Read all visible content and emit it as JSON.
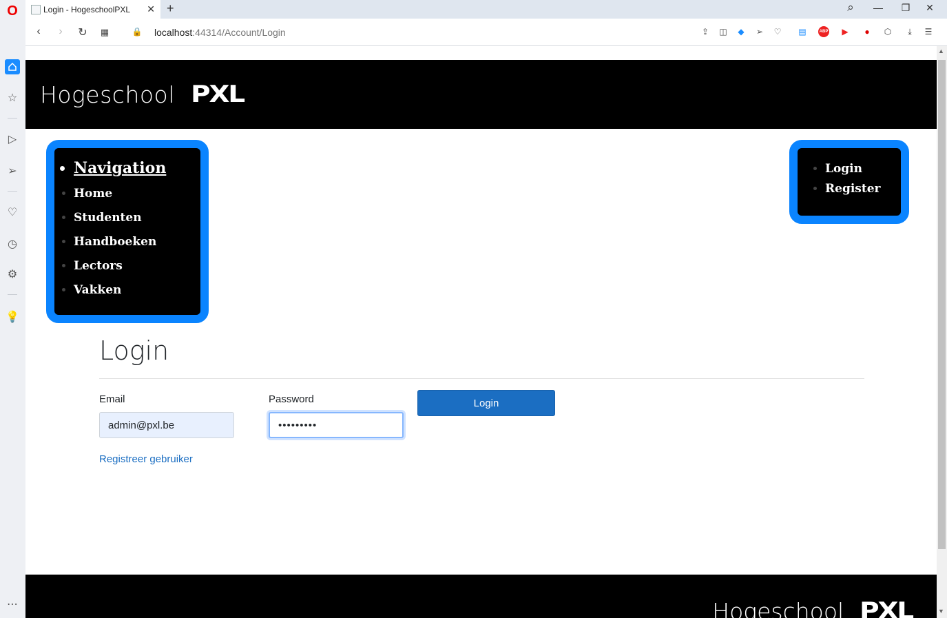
{
  "browser": {
    "tab_title": "Login - HogeschoolPXL",
    "tab_close": "✕",
    "new_tab": "+",
    "url_host": "localhost",
    "url_path": ":44314/Account/Login",
    "window_controls": {
      "search": "⌕",
      "minimize": "—",
      "restore": "❐",
      "close": "✕"
    }
  },
  "header": {
    "title": "Hogeschool",
    "logo": "PXL"
  },
  "nav_left": {
    "heading": "Navigation",
    "items": [
      "Home",
      "Studenten",
      "Handboeken",
      "Lectors",
      "Vakken"
    ]
  },
  "nav_right": {
    "items": [
      "Login",
      "Register"
    ]
  },
  "login_form": {
    "title": "Login",
    "email_label": "Email",
    "email_value": "admin@pxl.be",
    "password_label": "Password",
    "password_value": "•••••••••",
    "submit_label": "Login",
    "register_link": "Registreer gebruiker"
  },
  "footer": {
    "title": "Hogeschool",
    "logo": "PXL"
  },
  "colors": {
    "accent_nav_border": "#0a84ff",
    "button_primary": "#1b6ec2",
    "header_bg": "#000000"
  }
}
